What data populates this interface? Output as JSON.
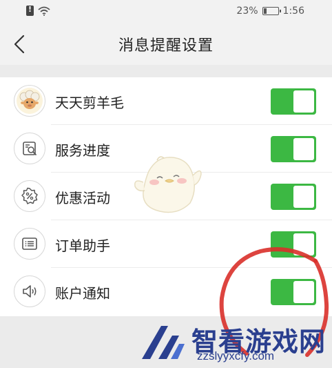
{
  "status_bar": {
    "battery_percent": "23%",
    "time": "1:56",
    "icons": [
      "sim-alert-icon",
      "wifi-icon",
      "battery-icon"
    ]
  },
  "header": {
    "title": "消息提醒设置",
    "back_icon": "chevron-left-icon"
  },
  "settings": [
    {
      "label": "天天剪羊毛",
      "icon": "sheep-avatar-icon",
      "enabled": true
    },
    {
      "label": "服务进度",
      "icon": "service-search-icon",
      "enabled": true
    },
    {
      "label": "优惠活动",
      "icon": "discount-badge-icon",
      "enabled": true
    },
    {
      "label": "订单助手",
      "icon": "order-list-icon",
      "enabled": true
    },
    {
      "label": "账户通知",
      "icon": "speaker-icon",
      "enabled": true
    }
  ],
  "watermark": {
    "title": "智看游戏网",
    "url": "zzslyyxcfy.com"
  },
  "colors": {
    "toggle_on": "#3cb843",
    "annotation_circle": "#d9302a",
    "watermark_blue": "#2a3f8f"
  }
}
